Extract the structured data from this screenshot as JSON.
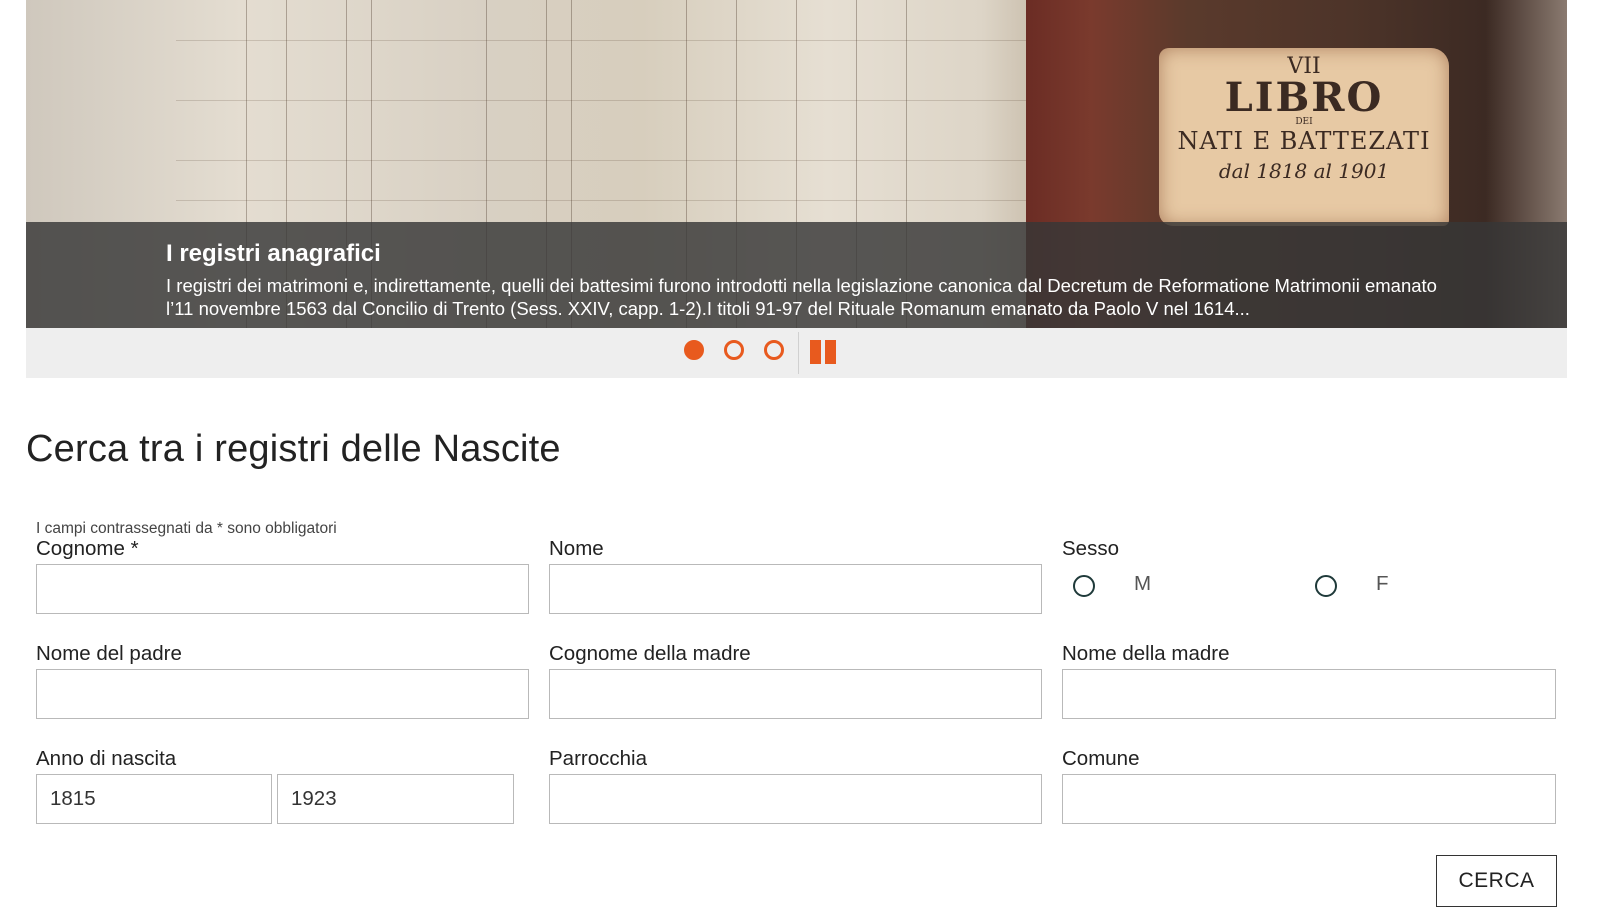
{
  "slider": {
    "caption_title": "I registri anagrafici",
    "caption_text": "I registri dei matrimoni e, indirettamente, quelli dei battesimi furono introdotti nella legislazione canonica dal Decretum de Reformatione Matrimonii emanato l’11 novembre 1563 dal Concilio di Trento (Sess. XXIV, capp. 1-2).I titoli 91-97 del Rituale Romanum emanato da Paolo V nel 1614...",
    "book_label": {
      "number": "VII",
      "word1": "LIBRO",
      "word2": "DEI",
      "word3": "NATI E BATTEZATI",
      "dates": "dal 1818 al 1901"
    },
    "active_slide": 1,
    "slide_count": 3,
    "accent_color": "#e85a1e"
  },
  "form": {
    "heading": "Cerca tra i registri delle Nascite",
    "required_note": "I campi contrassegnati da * sono obbligatori",
    "cognome_label": "Cognome *",
    "nome_label": "Nome",
    "sesso_label": "Sesso",
    "sesso_options": [
      "M",
      "F"
    ],
    "padre_label": "Nome del padre",
    "cognome_madre_label": "Cognome della madre",
    "nome_madre_label": "Nome della madre",
    "anno_label": "Anno di nascita",
    "anno_from": "1815",
    "anno_to": "1923",
    "parrocchia_label": "Parrocchia",
    "comune_label": "Comune",
    "submit_label": "CERCA"
  }
}
